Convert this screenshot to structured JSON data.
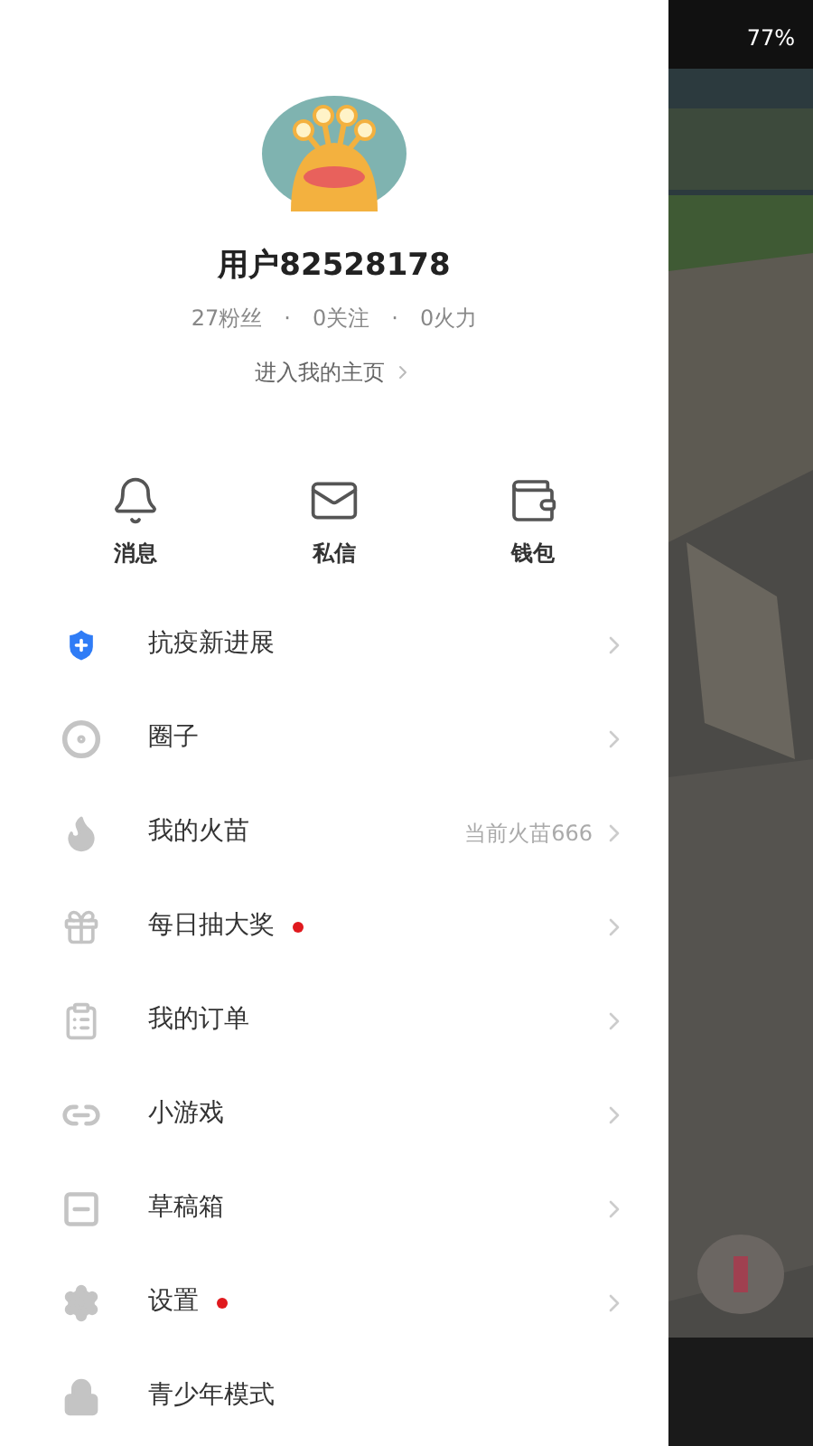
{
  "status_bar": {
    "battery": "77%"
  },
  "profile": {
    "name": "用户82528178",
    "stats": [
      "27粉丝",
      "0关注",
      "0火力"
    ],
    "separator": "·",
    "home_link": "进入我的主页"
  },
  "quick_actions": [
    {
      "kind": "bell",
      "label": "消息"
    },
    {
      "kind": "mail",
      "label": "私信"
    },
    {
      "kind": "wallet",
      "label": "钱包"
    }
  ],
  "menu": [
    {
      "kind": "shield",
      "label": "抗疫新进展",
      "dot": false,
      "arrow": true
    },
    {
      "kind": "circle",
      "label": "圈子",
      "dot": false,
      "arrow": true
    },
    {
      "kind": "flame",
      "label": "我的火苗",
      "hint": "当前火苗666",
      "dot": false,
      "arrow": true
    },
    {
      "kind": "gift",
      "label": "每日抽大奖",
      "dot": true,
      "arrow": true
    },
    {
      "kind": "clipboard",
      "label": "我的订单",
      "dot": false,
      "arrow": true
    },
    {
      "kind": "link",
      "label": "小游戏",
      "dot": false,
      "arrow": true
    },
    {
      "kind": "drafts",
      "label": "草稿箱",
      "dot": false,
      "arrow": true
    },
    {
      "kind": "gear",
      "label": "设置",
      "dot": true,
      "arrow": true
    },
    {
      "kind": "lock",
      "label": "青少年模式",
      "dot": false,
      "arrow": false
    }
  ]
}
